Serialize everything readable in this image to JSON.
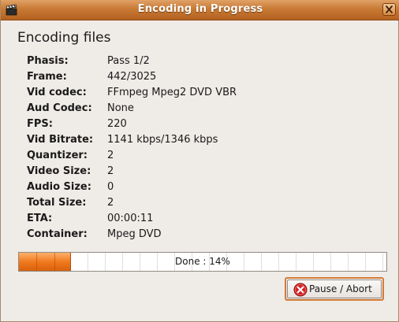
{
  "window": {
    "title": "Encoding in Progress",
    "close_icon": "close-icon",
    "app_icon": "clapperboard-icon",
    "accent_color": "#c97a35"
  },
  "main": {
    "heading": "Encoding files",
    "fields": [
      {
        "label": "Phasis:",
        "value": "Pass 1/2"
      },
      {
        "label": "Frame:",
        "value": "442/3025"
      },
      {
        "label": "Vid codec:",
        "value": "FFmpeg Mpeg2 DVD VBR"
      },
      {
        "label": "Aud Codec:",
        "value": "None"
      },
      {
        "label": "FPS:",
        "value": "220"
      },
      {
        "label": "Vid Bitrate:",
        "value": "1141 kbps/1346 kbps"
      },
      {
        "label": "Quantizer:",
        "value": "2"
      },
      {
        "label": "Video Size:",
        "value": "2"
      },
      {
        "label": "Audio Size:",
        "value": "0"
      },
      {
        "label": "Total Size:",
        "value": "2"
      },
      {
        "label": "ETA:",
        "value": "00:00:11"
      },
      {
        "label": "Container:",
        "value": "Mpeg DVD"
      }
    ]
  },
  "progress": {
    "percent": 14,
    "text": "Done : 14%",
    "fill_color": "#f07a1e"
  },
  "actions": {
    "pause_abort_label": "Pause / Abort",
    "pause_abort_icon": "stop-icon"
  }
}
